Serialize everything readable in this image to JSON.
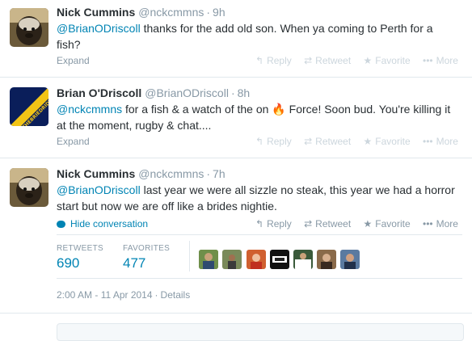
{
  "tweets": [
    {
      "fullname": "Nick Cummins",
      "username": "@nckcmmns",
      "time": "9h",
      "mention": "@BrianODriscoll",
      "text_line1": " thanks for the add old son. When ya coming to Perth for a",
      "text_line2": "fish?",
      "expand": "Expand"
    },
    {
      "fullname": "Brian O'Driscoll",
      "username": "@BrianODriscoll",
      "time": "8h",
      "mention": "@nckcmmns",
      "text_part1": " for a fish & a watch of the on ",
      "text_part2": " Force! Soon bud. You're killing it",
      "text_line2": "at the moment, rugby & chat....",
      "expand": "Expand",
      "avatar_text": "THEBRIEDRIDTPIER"
    },
    {
      "fullname": "Nick Cummins",
      "username": "@nckcmmns",
      "time": "7h",
      "mention": "@BrianODriscoll",
      "text_line1": " last year we were all sizzle no steak, this year we had a horror",
      "text_line2": "start but now we are off like a brides nightie.",
      "hide_conversation": "Hide conversation",
      "retweets_label": "RETWEETS",
      "retweets_count": "690",
      "favorites_label": "FAVORITES",
      "favorites_count": "477",
      "timestamp": "2:00 AM - 11 Apr 2014",
      "details": "Details"
    }
  ],
  "actions": {
    "reply": "Reply",
    "retweet": "Retweet",
    "favorite": "Favorite",
    "more": "More"
  },
  "separator": "·",
  "colors": {
    "link": "#0084b4",
    "muted": "#8899a6",
    "faint_action": "#ccd6dd",
    "border": "#e1e8ed"
  },
  "icons": [
    "reply-icon",
    "retweet-icon",
    "star-icon",
    "more-dots-icon",
    "speech-bubble-icon",
    "flame-emoji-icon"
  ]
}
